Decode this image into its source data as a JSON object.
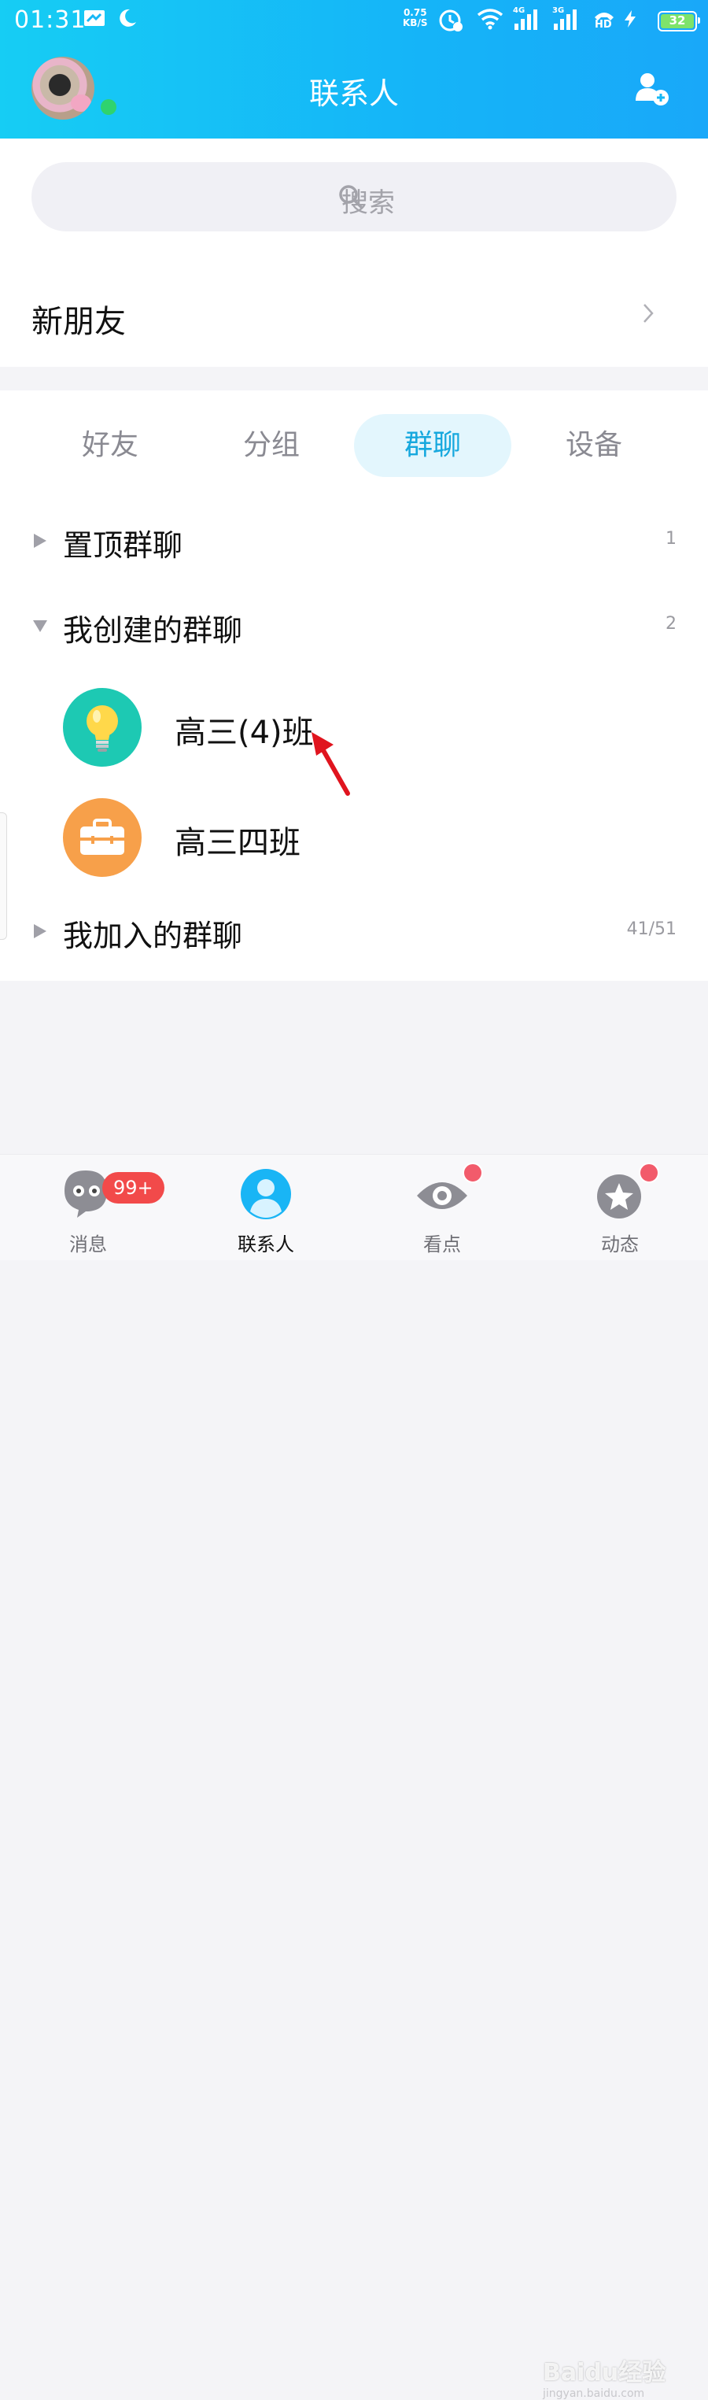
{
  "status_bar": {
    "time": "01:31",
    "speed_value": "0.75",
    "speed_unit": "KB/S",
    "net1": "4G",
    "net2": "3G",
    "hd": "HD",
    "battery": "32"
  },
  "header": {
    "title": "联系人"
  },
  "search": {
    "placeholder": "搜索"
  },
  "new_friends": {
    "label": "新朋友"
  },
  "tabs": [
    {
      "label": "好友",
      "active": false
    },
    {
      "label": "分组",
      "active": false
    },
    {
      "label": "群聊",
      "active": true
    },
    {
      "label": "设备",
      "active": false
    }
  ],
  "sections": [
    {
      "name": "置顶群聊",
      "count": "1",
      "expanded": false
    },
    {
      "name": "我创建的群聊",
      "count": "2",
      "expanded": true
    },
    {
      "name": "我加入的群聊",
      "count": "41/51",
      "expanded": false
    }
  ],
  "groups": [
    {
      "name": "高三(4)班",
      "icon": "lightbulb-icon",
      "color": "#1dc9b3"
    },
    {
      "name": "高三四班",
      "icon": "briefcase-icon",
      "color": "#f7a04a"
    }
  ],
  "bottom_nav": [
    {
      "label": "消息",
      "badge": "99+"
    },
    {
      "label": "联系人"
    },
    {
      "label": "看点"
    },
    {
      "label": "动态"
    }
  ],
  "watermark": {
    "main": "Baidu经验",
    "sub": "jingyan.baidu.com"
  },
  "colors": {
    "header": "#16b8f6",
    "accent": "#16a8de",
    "badge": "#f24a4a",
    "online": "#2fd36e"
  }
}
